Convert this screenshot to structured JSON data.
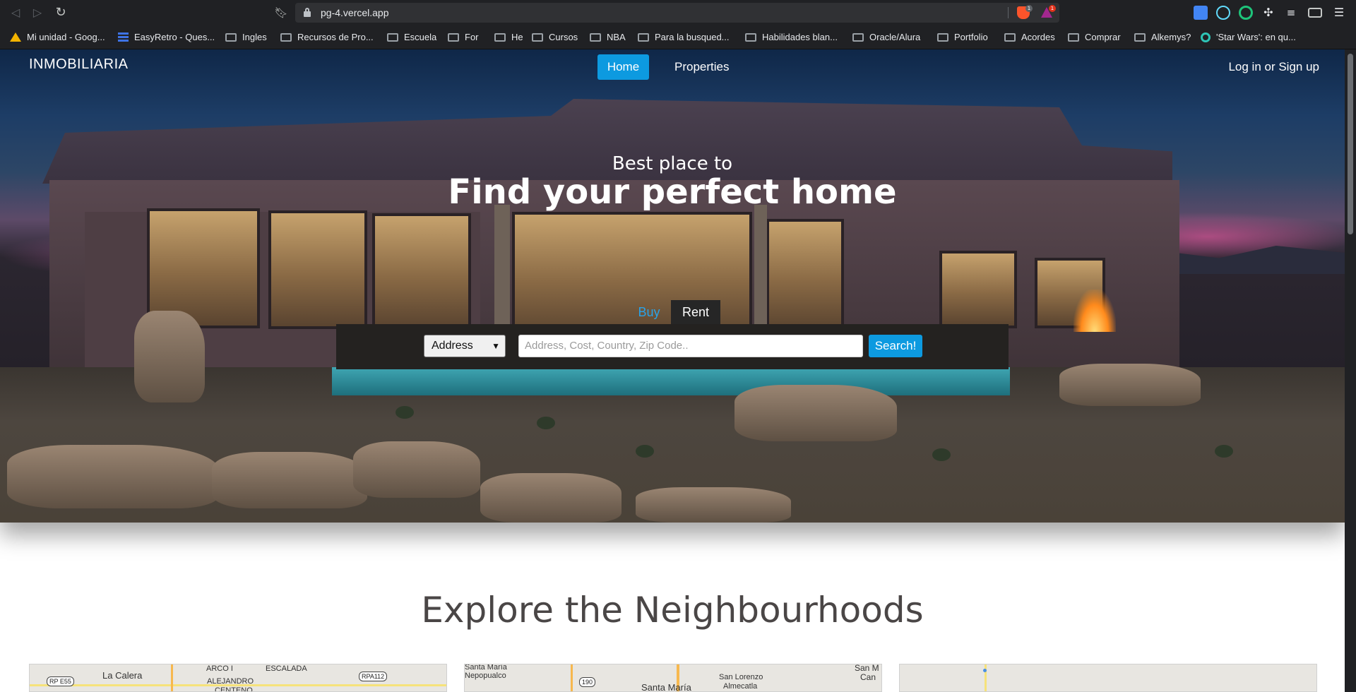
{
  "browser": {
    "url": "pg-4.vercel.app",
    "brave_badge": "1",
    "rewards_badge": "1",
    "bookmarks": [
      {
        "label": "Mi unidad - Goog...",
        "icon": "google-drive-icon"
      },
      {
        "label": "EasyRetro - Ques...",
        "icon": "easyretro-icon"
      },
      {
        "label": "Ingles",
        "icon": "folder-icon"
      },
      {
        "label": "Recursos de Pro...",
        "icon": "folder-icon"
      },
      {
        "label": "Escuela",
        "icon": "folder-icon"
      },
      {
        "label": "For",
        "icon": "folder-icon"
      },
      {
        "label": "He",
        "icon": "folder-icon"
      },
      {
        "label": "Cursos",
        "icon": "folder-icon"
      },
      {
        "label": "NBA",
        "icon": "folder-icon"
      },
      {
        "label": "Para la busqued...",
        "icon": "folder-icon"
      },
      {
        "label": "Habilidades blan...",
        "icon": "folder-icon"
      },
      {
        "label": "Oracle/Alura",
        "icon": "folder-icon"
      },
      {
        "label": "Portfolio",
        "icon": "folder-icon"
      },
      {
        "label": "Acordes",
        "icon": "folder-icon"
      },
      {
        "label": "Comprar",
        "icon": "folder-icon"
      },
      {
        "label": "Alkemys?",
        "icon": "folder-icon"
      },
      {
        "label": "'Star Wars': en qu...",
        "icon": "star-wars-icon"
      }
    ]
  },
  "site": {
    "brand": "INMOBILIARIA",
    "nav": {
      "home": "Home",
      "properties": "Properties"
    },
    "auth": "Log in or Sign up",
    "accent_color": "#0d9ae0"
  },
  "hero": {
    "subtitle": "Best place to",
    "title": "Find your perfect home",
    "tabs": {
      "buy": "Buy",
      "rent": "Rent"
    },
    "search": {
      "select_value": "Address",
      "placeholder": "Address, Cost, Country, Zip Code..",
      "button": "Search!"
    }
  },
  "neighbourhoods": {
    "title": "Explore the Neighbourhoods",
    "maps": [
      {
        "labels": [
          "La Calera",
          "ARCO I",
          "ESCALADA",
          "ALEJANDRO",
          "CENTENO"
        ],
        "shields": [
          "RP E55",
          "RPA112"
        ]
      },
      {
        "labels": [
          "Santa María",
          "Nepopualco",
          "Santa María",
          "San Lorenzo",
          "Almecatla",
          "San M",
          "Can"
        ],
        "shields": [
          "190"
        ]
      },
      {
        "labels": [],
        "shields": []
      }
    ]
  }
}
